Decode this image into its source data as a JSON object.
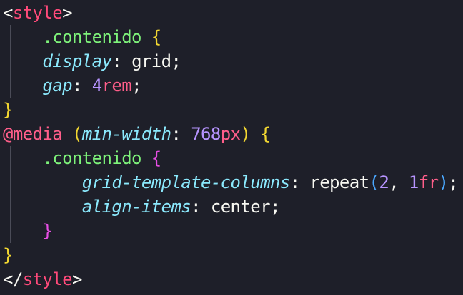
{
  "editor": {
    "lines": [
      {
        "tokens": [
          [
            "punct",
            "<"
          ],
          [
            "tag",
            "style"
          ],
          [
            "punct",
            ">"
          ]
        ]
      },
      {
        "tokens": [
          [
            "sp",
            "    "
          ],
          [
            "sel",
            ".contenido"
          ],
          [
            "sp",
            " "
          ],
          [
            "brace",
            "{"
          ]
        ]
      },
      {
        "tokens": [
          [
            "sp",
            "    "
          ],
          [
            "prop",
            "display"
          ],
          [
            "punct",
            ":"
          ],
          [
            "sp",
            " "
          ],
          [
            "val",
            "grid"
          ],
          [
            "punct",
            ";"
          ]
        ]
      },
      {
        "tokens": [
          [
            "sp",
            "    "
          ],
          [
            "prop",
            "gap"
          ],
          [
            "punct",
            ":"
          ],
          [
            "sp",
            " "
          ],
          [
            "num",
            "4"
          ],
          [
            "unit",
            "rem"
          ],
          [
            "punct",
            ";"
          ]
        ]
      },
      {
        "tokens": [
          [
            "brace",
            "}"
          ]
        ]
      },
      {
        "tokens": [
          [
            "at",
            "@media"
          ],
          [
            "sp",
            " "
          ],
          [
            "paren",
            "("
          ],
          [
            "prop",
            "min-width"
          ],
          [
            "punct",
            ":"
          ],
          [
            "sp",
            " "
          ],
          [
            "num",
            "768"
          ],
          [
            "unit",
            "px"
          ],
          [
            "paren",
            ")"
          ],
          [
            "sp",
            " "
          ],
          [
            "brace",
            "{"
          ]
        ]
      },
      {
        "tokens": [
          [
            "sp",
            "    "
          ],
          [
            "sel",
            ".contenido"
          ],
          [
            "sp",
            " "
          ],
          [
            "brace2",
            "{"
          ]
        ]
      },
      {
        "tokens": [
          [
            "sp",
            "        "
          ],
          [
            "prop",
            "grid-template-columns"
          ],
          [
            "punct",
            ":"
          ],
          [
            "sp",
            " "
          ],
          [
            "val",
            "repeat"
          ],
          [
            "paren2",
            "("
          ],
          [
            "num",
            "2"
          ],
          [
            "punct",
            ","
          ],
          [
            "sp",
            " "
          ],
          [
            "num",
            "1"
          ],
          [
            "unit",
            "fr"
          ],
          [
            "paren2",
            ")"
          ],
          [
            "punct",
            ";"
          ]
        ]
      },
      {
        "tokens": [
          [
            "sp",
            "        "
          ],
          [
            "prop",
            "align-items"
          ],
          [
            "punct",
            ":"
          ],
          [
            "sp",
            " "
          ],
          [
            "val",
            "center"
          ],
          [
            "punct",
            ";"
          ]
        ]
      },
      {
        "tokens": [
          [
            "sp",
            "    "
          ],
          [
            "brace2",
            "}"
          ]
        ]
      },
      {
        "tokens": [
          [
            "brace",
            "}"
          ]
        ]
      },
      {
        "tokens": [
          [
            "punct",
            "</"
          ],
          [
            "tag",
            "style"
          ],
          [
            "punct",
            ">"
          ]
        ]
      }
    ],
    "guides": [
      [],
      [
        "g1"
      ],
      [
        "g1"
      ],
      [
        "g1"
      ],
      [],
      [],
      [
        "g1"
      ],
      [
        "g1",
        "g2"
      ],
      [
        "g1",
        "g2"
      ],
      [
        "g1"
      ],
      [],
      []
    ]
  },
  "colors": {
    "background": "#1e1f29",
    "tag": "#ff4a7a",
    "selector": "#7ef37a",
    "brace": "#f1d631",
    "brace_nested": "#e64ee3",
    "property": "#8be9fd",
    "number": "#b794ff",
    "unit": "#ff5e8a",
    "paren_nested": "#4aa8ff"
  }
}
